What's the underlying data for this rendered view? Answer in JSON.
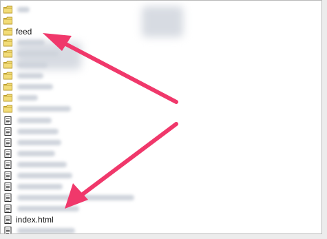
{
  "files": {
    "folder_rows": [
      {
        "label": "",
        "blur_w": 18
      },
      {
        "label": "",
        "blur_w": 0
      },
      {
        "label": "feed",
        "blur_w": 0
      },
      {
        "label": "",
        "blur_w": 40
      },
      {
        "label": "",
        "blur_w": 60
      },
      {
        "label": "",
        "blur_w": 44
      },
      {
        "label": "",
        "blur_w": 38
      },
      {
        "label": "",
        "blur_w": 52
      },
      {
        "label": "",
        "blur_w": 30
      },
      {
        "label": "",
        "blur_w": 78
      }
    ],
    "file_rows": [
      {
        "label": "",
        "blur_w": 50
      },
      {
        "label": "",
        "blur_w": 60
      },
      {
        "label": "",
        "blur_w": 64
      },
      {
        "label": "",
        "blur_w": 55
      },
      {
        "label": "",
        "blur_w": 72
      },
      {
        "label": "",
        "blur_w": 80
      },
      {
        "label": "",
        "blur_w": 66
      },
      {
        "label": "",
        "blur_w": 170
      },
      {
        "label": "",
        "blur_w": 90
      },
      {
        "label": "index.html",
        "blur_w": 0
      },
      {
        "label": "",
        "blur_w": 84
      },
      {
        "label": "",
        "blur_w": 70
      }
    ]
  },
  "colors": {
    "folder_fill": "#f2dc78",
    "folder_stroke": "#b89a2b",
    "arrow": "#f0386b"
  },
  "icons": {
    "folder": "folder-icon",
    "file": "file-icon"
  }
}
